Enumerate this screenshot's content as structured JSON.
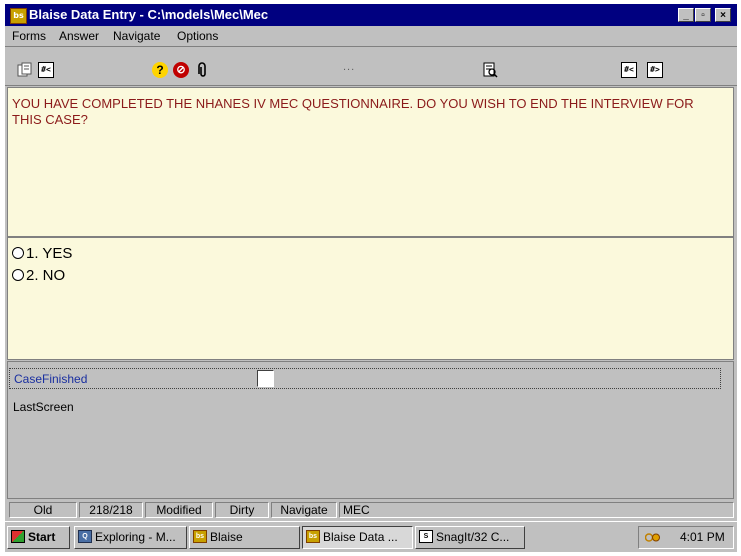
{
  "window": {
    "app_icon": "bs",
    "title": "Blaise Data Entry - C:\\models\\Mec\\Mec",
    "controls": [
      "_",
      "ħ",
      "X"
    ]
  },
  "menu": {
    "items": [
      {
        "label": "Forms"
      },
      {
        "label": "Answer"
      },
      {
        "label": "Navigate"
      },
      {
        "label": "Options"
      }
    ]
  },
  "toolbar": {
    "icons": [
      "copy-form-icon",
      "previous-form-icon",
      "help-icon",
      "no-entry-icon",
      "attachment-icon",
      "search-doc-icon",
      "previous-field-icon",
      "next-field-icon"
    ],
    "dots": "..."
  },
  "question": {
    "text": "YOU HAVE COMPLETED THE NHANES IV MEC QUESTIONNAIRE. DO YOU WISH TO END THE INTERVIEW FOR THIS CASE?"
  },
  "answers": {
    "options": [
      {
        "label": "1. YES"
      },
      {
        "label": "2. NO"
      }
    ]
  },
  "fields": {
    "active_name": "CaseFinished",
    "active_value": "",
    "next_name": "LastScreen"
  },
  "statusbar": {
    "cells": [
      "Old",
      "218/218",
      "Modified",
      "Dirty",
      "Navigate",
      "MEC"
    ]
  },
  "taskbar": {
    "start_label": "Start",
    "buttons": [
      {
        "label": "Exploring - M..."
      },
      {
        "label": "Blaise"
      },
      {
        "label": "Blaise Data ..."
      },
      {
        "label": "SnagIt/32 C..."
      }
    ],
    "clock": "4:01 PM"
  },
  "colors": {
    "titlebar": "#000080",
    "question_text": "#8b1a1a",
    "panel_bg": "#fbf9dc",
    "active_field_text": "#1a2fa0",
    "chrome": "#c0c0c0"
  }
}
